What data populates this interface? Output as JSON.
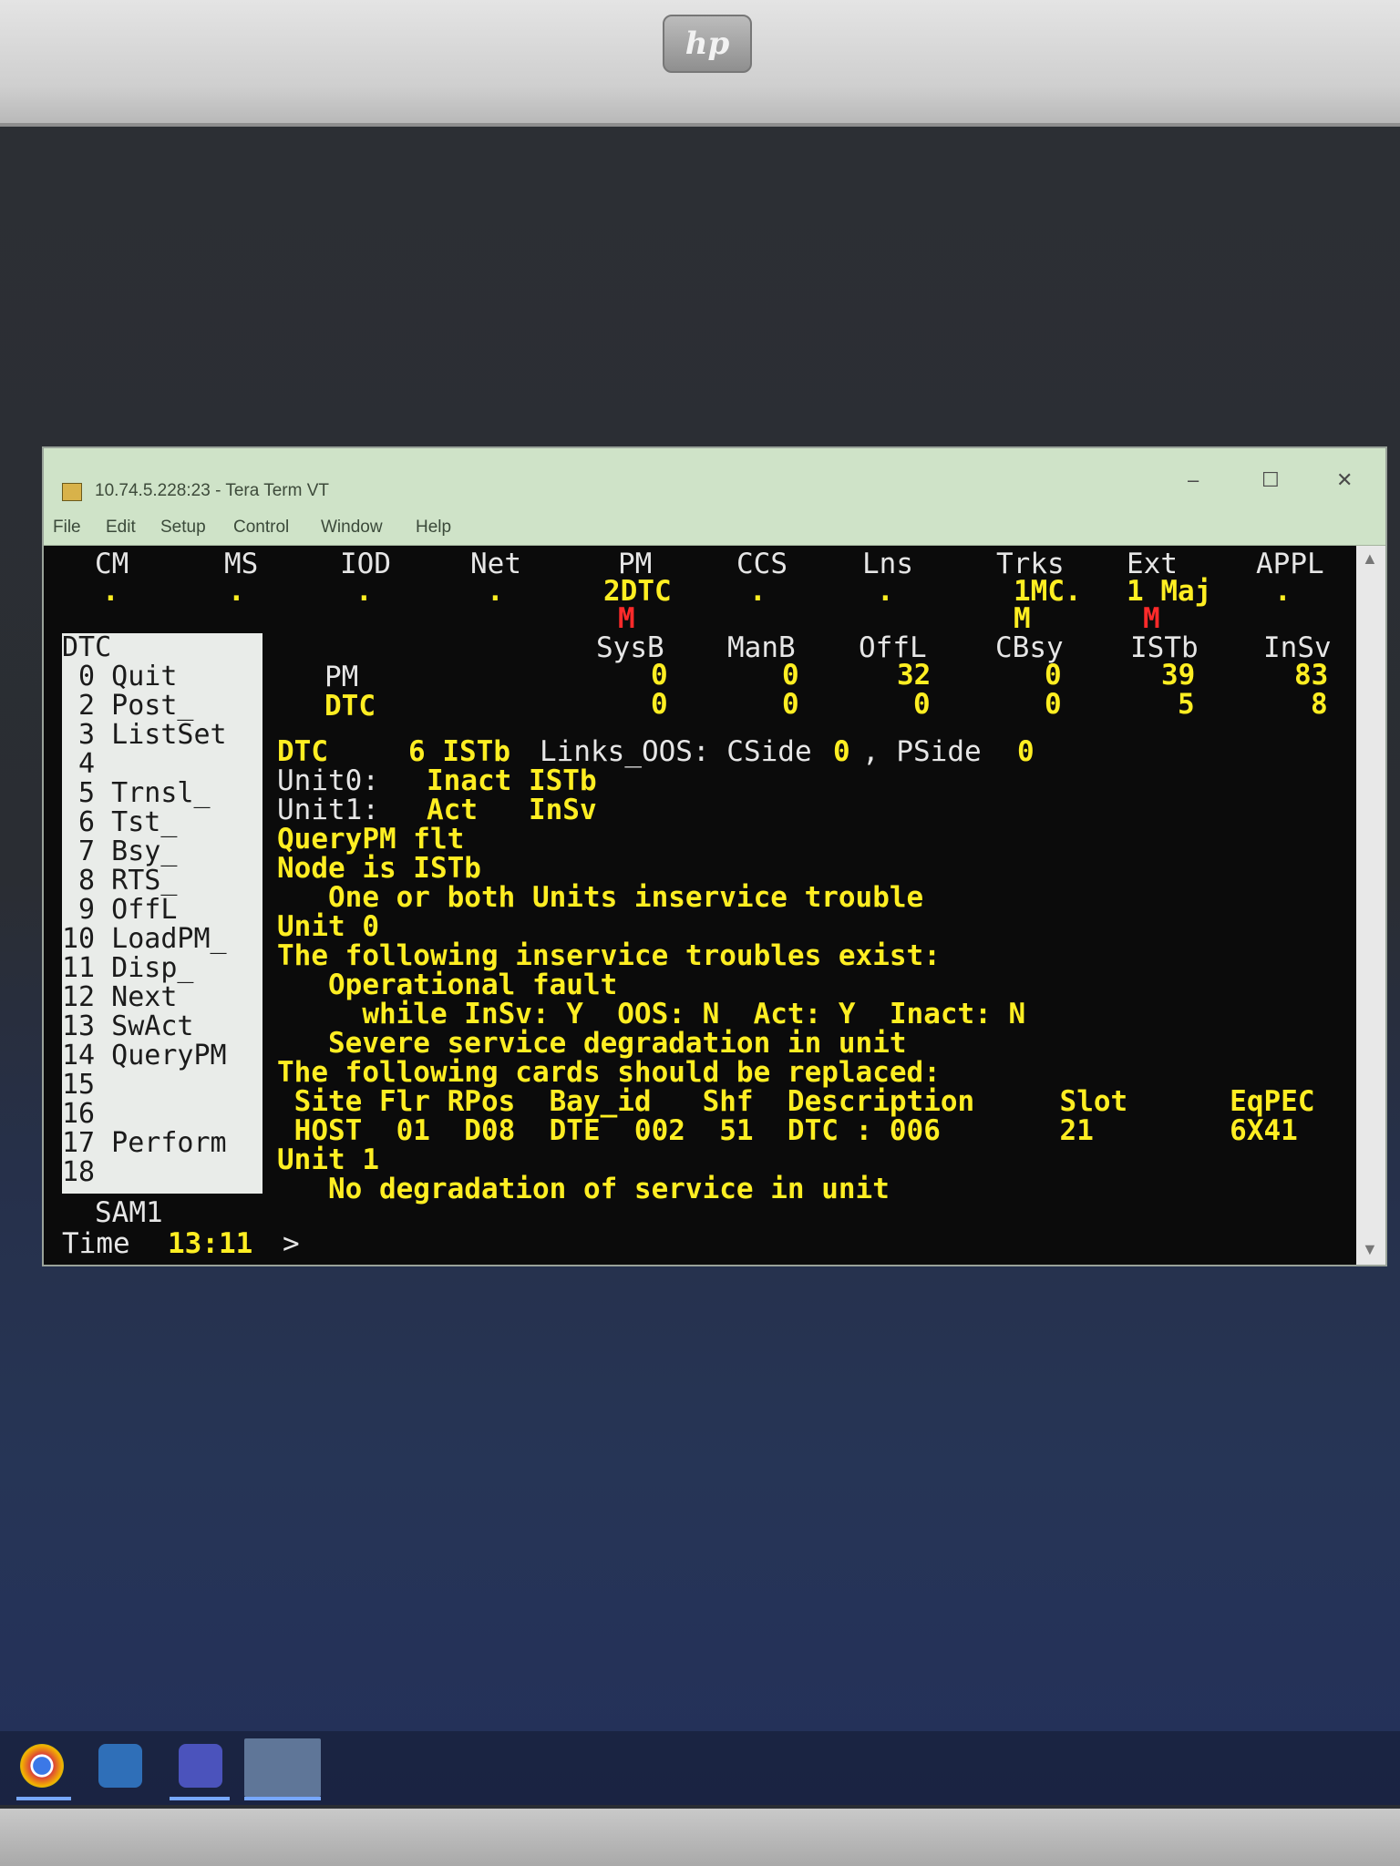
{
  "window": {
    "title": "10.74.5.228:23 - Tera Term VT",
    "minimize": "–",
    "maximize": "☐",
    "close": "✕"
  },
  "menu": [
    "File",
    "Edit",
    "Setup",
    "Control",
    "Window",
    "Help"
  ],
  "header": {
    "CM": "CM",
    "MS": "MS",
    "IOD": "IOD",
    "Net": "Net",
    "PM": "PM",
    "CCS": "CCS",
    "Lns": "Lns",
    "Trks": "Trks",
    "Ext": "Ext",
    "APPL": "APPL",
    "dot": ".",
    "pm_value": "2DTC",
    "trks_value": "1MC.",
    "ext_value": "1 Maj",
    "pm_flag": "M",
    "trks_flag": "M",
    "ext_flag": "M"
  },
  "status_table": {
    "columns": [
      "SysB",
      "ManB",
      "OffL",
      "CBsy",
      "ISTb",
      "InSv"
    ],
    "rows": [
      {
        "label": "PM",
        "values": [
          "0",
          "0",
          "32",
          "0",
          "39",
          "83"
        ]
      },
      {
        "label": "DTC",
        "values": [
          "0",
          "0",
          "0",
          "0",
          "5",
          "8"
        ]
      }
    ]
  },
  "sidebar": {
    "title": "DTC",
    "items": [
      " 0 Quit",
      " 2 Post_",
      " 3 ListSet",
      " 4",
      " 5 Trnsl_",
      " 6 Tst_",
      " 7 Bsy_",
      " 8 RTS_",
      " 9 OffL",
      "10 LoadPM_",
      "11 Disp_",
      "12 Next",
      "13 SwAct",
      "14 QueryPM",
      "15",
      "16",
      "17 Perform",
      "18"
    ],
    "user": "SAM1",
    "time_label": "Time",
    "time_value": "13:11",
    "prompt": ">"
  },
  "output": {
    "dtc_label": "DTC",
    "dtc_count": "6 ISTb",
    "links_label": "Links_OOS: CSide",
    "cside_value": "0",
    "pside_label": ", PSide",
    "pside_value": "0",
    "unit0_label": "Unit0:",
    "unit0_state": "Inact ISTb",
    "unit1_label": "Unit1:",
    "unit1_state": "Act   InSv",
    "lines": [
      "QueryPM flt",
      "Node is ISTb",
      "   One or both Units inservice trouble",
      "Unit 0",
      "The following inservice troubles exist:",
      "   Operational fault",
      "     while InSv: Y  OOS: N  Act: Y  Inact: N",
      "   Severe service degradation in unit",
      "The following cards should be replaced:",
      " Site Flr RPos  Bay_id   Shf  Description     Slot      EqPEC",
      " HOST  01  D08  DTE  002  51  DTC : 006       21        6X41",
      "Unit 1",
      "   No degradation of service in unit"
    ]
  }
}
